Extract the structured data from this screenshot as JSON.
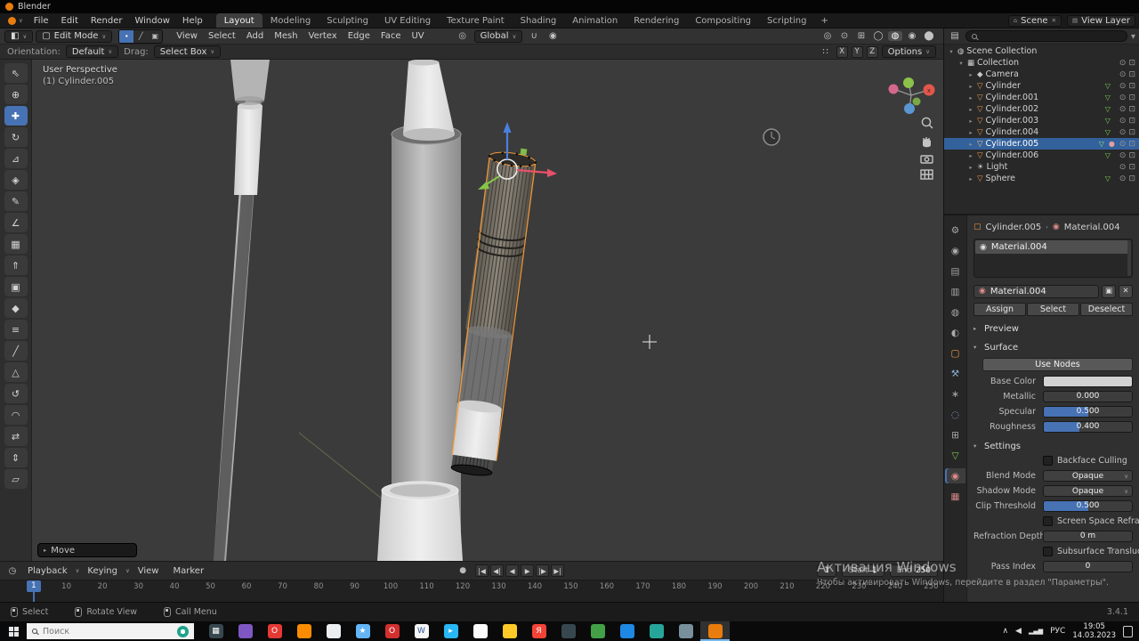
{
  "titlebar": {
    "app": "Blender"
  },
  "icons": {
    "chevron": "∨",
    "tri_r": "▸",
    "tri_d": "▾",
    "close": "✕",
    "plus": "+",
    "grid": "∷",
    "editor_3d": "◧",
    "editor_outliner": "▤",
    "editor_props": "⌂",
    "editor_timeline": "◷",
    "mode_cube": "▢",
    "pivot": "◎",
    "magnet": "∪",
    "proportional": "◉",
    "filter": "▼",
    "breadcrumb_sep": "›",
    "sphere": "◉",
    "copy": "▣",
    "caret_up": "∧",
    "volume": "◀",
    "network": "▂▄▆",
    "dot": "●"
  },
  "menubar": {
    "menus": [
      "File",
      "Edit",
      "Render",
      "Window",
      "Help"
    ],
    "workspaces": [
      {
        "label": "Layout",
        "active": true
      },
      {
        "label": "Modeling"
      },
      {
        "label": "Sculpting"
      },
      {
        "label": "UV Editing"
      },
      {
        "label": "Texture Paint"
      },
      {
        "label": "Shading"
      },
      {
        "label": "Animation"
      },
      {
        "label": "Rendering"
      },
      {
        "label": "Compositing"
      },
      {
        "label": "Scripting"
      }
    ],
    "scene_label": "Scene",
    "view_layer_label": "View Layer"
  },
  "viewport_header": {
    "mode": "Edit Mode",
    "select_modes": [
      {
        "name": "vertex-select",
        "glyph": "∙",
        "active": true
      },
      {
        "name": "edge-select",
        "glyph": "╱"
      },
      {
        "name": "face-select",
        "glyph": "▣"
      }
    ],
    "menus": [
      "View",
      "Select",
      "Add",
      "Mesh",
      "Vertex",
      "Edge",
      "Face",
      "UV"
    ],
    "orientation": "Global",
    "toggles": [
      {
        "name": "show-gizmo",
        "glyph": "◎"
      },
      {
        "name": "show-overlays",
        "glyph": "⊙"
      },
      {
        "name": "toggle-xray",
        "glyph": "⊞"
      },
      {
        "name": "shading-wireframe",
        "glyph": "◯"
      },
      {
        "name": "shading-solid",
        "glyph": "◍",
        "active": true
      },
      {
        "name": "shading-material",
        "glyph": "◉"
      },
      {
        "name": "shading-rendered",
        "glyph": "⬤"
      }
    ]
  },
  "tool_settings": {
    "orientation_label": "Orientation:",
    "orientation_value": "Default",
    "drag_label": "Drag:",
    "drag_value": "Select Box",
    "axes": [
      "X",
      "Y",
      "Z"
    ],
    "options_label": "Options"
  },
  "toolbar": {
    "tools": [
      {
        "name": "select-box",
        "glyph": "⇖"
      },
      {
        "name": "cursor",
        "glyph": "⊕"
      },
      {
        "name": "move",
        "glyph": "✚",
        "active": true
      },
      {
        "name": "rotate",
        "glyph": "↻"
      },
      {
        "name": "scale",
        "glyph": "⊿"
      },
      {
        "name": "transform",
        "glyph": "◈"
      },
      {
        "name": "annotate",
        "glyph": "✎"
      },
      {
        "name": "measure",
        "glyph": "∠"
      },
      {
        "name": "add-cube",
        "glyph": "▦"
      },
      {
        "name": "extrude-region",
        "glyph": "⇑"
      },
      {
        "name": "inset-faces",
        "glyph": "▣"
      },
      {
        "name": "bevel",
        "glyph": "◆"
      },
      {
        "name": "loop-cut",
        "glyph": "≡"
      },
      {
        "name": "knife",
        "glyph": "╱"
      },
      {
        "name": "poly-build",
        "glyph": "△"
      },
      {
        "name": "spin",
        "glyph": "↺"
      },
      {
        "name": "smooth",
        "glyph": "◠"
      },
      {
        "name": "edge-slide",
        "glyph": "⇄"
      },
      {
        "name": "shrink-fatten",
        "glyph": "⇕"
      },
      {
        "name": "shear",
        "glyph": "▱"
      }
    ]
  },
  "viewport": {
    "view_label": "User Perspective",
    "object_label": "(1) Cylinder.005",
    "operator_label": "Move",
    "gizmo_x_label": "x",
    "selection_color": "#f59a38",
    "accent_color": "#4772b3"
  },
  "outliner": {
    "items": [
      {
        "label": "Scene Collection",
        "arrow": "▾",
        "icon": "◍",
        "icon_color": "#d0d0d0",
        "indent": 0
      },
      {
        "label": "Collection",
        "arrow": "▾",
        "icon": "▦",
        "icon_color": "#d0d0d0",
        "indent": 1,
        "eye": "⊙",
        "cam": "⊡"
      },
      {
        "label": "Camera",
        "arrow": "▸",
        "icon": "◆",
        "icon_color": "#c9c9c9",
        "indent": 2,
        "eye": "⊙",
        "cam": "⊡"
      },
      {
        "label": "Cylinder",
        "arrow": "▸",
        "icon": "▽",
        "icon_color": "#ef9b4e",
        "badge": "▽",
        "badge_color": "#7fce52",
        "indent": 2,
        "eye": "⊙",
        "cam": "⊡"
      },
      {
        "label": "Cylinder.001",
        "arrow": "▸",
        "icon": "▽",
        "icon_color": "#ef9b4e",
        "badge": "▽",
        "badge_color": "#7fce52",
        "indent": 2,
        "eye": "⊙",
        "cam": "⊡"
      },
      {
        "label": "Cylinder.002",
        "arrow": "▸",
        "icon": "▽",
        "icon_color": "#ef9b4e",
        "badge": "▽",
        "badge_color": "#7fce52",
        "indent": 2,
        "eye": "⊙",
        "cam": "⊡"
      },
      {
        "label": "Cylinder.003",
        "arrow": "▸",
        "icon": "▽",
        "icon_color": "#ef9b4e",
        "badge": "▽",
        "badge_color": "#7fce52",
        "indent": 2,
        "eye": "⊙",
        "cam": "⊡"
      },
      {
        "label": "Cylinder.004",
        "arrow": "▸",
        "icon": "▽",
        "icon_color": "#ef9b4e",
        "badge": "▽",
        "badge_color": "#7fce52",
        "indent": 2,
        "eye": "⊙",
        "cam": "⊡"
      },
      {
        "label": "Cylinder.005",
        "arrow": "▸",
        "icon": "▽",
        "icon_color": "#ffc588",
        "badge": "▽",
        "badge_color": "#9fe07a",
        "badge2": "●",
        "badge2_color": "#e0a0a0",
        "indent": 2,
        "eye": "⊙",
        "cam": "⊡",
        "selected": true
      },
      {
        "label": "Cylinder.006",
        "arrow": "▸",
        "icon": "▽",
        "icon_color": "#ef9b4e",
        "badge": "▽",
        "badge_color": "#7fce52",
        "indent": 2,
        "eye": "⊙",
        "cam": "⊡"
      },
      {
        "label": "Light",
        "arrow": "▸",
        "icon": "☀",
        "icon_color": "#cfcfcf",
        "indent": 2,
        "eye": "⊙",
        "cam": "⊡"
      },
      {
        "label": "Sphere",
        "arrow": "▸",
        "icon": "▽",
        "icon_color": "#ef9b4e",
        "badge": "▽",
        "badge_color": "#7fce52",
        "indent": 2,
        "eye": "⊙",
        "cam": "⊡"
      }
    ]
  },
  "properties": {
    "tabs": [
      {
        "name": "tab-tool",
        "glyph": "⚙"
      },
      {
        "name": "tab-render",
        "glyph": "◉"
      },
      {
        "name": "tab-output",
        "glyph": "▤"
      },
      {
        "name": "tab-view-layer",
        "glyph": "▥"
      },
      {
        "name": "tab-scene",
        "glyph": "◍"
      },
      {
        "name": "tab-world",
        "glyph": "◐"
      },
      {
        "name": "tab-object",
        "glyph": "▢",
        "color": "#ef9b4e"
      },
      {
        "name": "tab-modifiers",
        "glyph": "⚒",
        "color": "#8aa8ce"
      },
      {
        "name": "tab-particles",
        "glyph": "∗"
      },
      {
        "name": "tab-physics",
        "glyph": "◌",
        "color": "#8aa8ce"
      },
      {
        "name": "tab-constraints",
        "glyph": "⊞"
      },
      {
        "name": "tab-object-data",
        "glyph": "▽",
        "color": "#7fce52"
      },
      {
        "name": "tab-material",
        "glyph": "◉",
        "color": "#de8a8a",
        "active": true
      },
      {
        "name": "tab-texture",
        "glyph": "▦",
        "color": "#de8a8a"
      }
    ],
    "breadcrumb_object": "Cylinder.005",
    "breadcrumb_material": "Material.004",
    "slot_item": "Material.004",
    "material_name": "Material.004",
    "assign": "Assign",
    "select": "Select",
    "deselect": "Deselect",
    "preview_label": "Preview",
    "surface_label": "Surface",
    "use_nodes": "Use Nodes",
    "base_color_label": "Base Color",
    "metallic_label": "Metallic",
    "metallic": "0.000",
    "specular_label": "Specular",
    "specular": "0.500",
    "roughness_label": "Roughness",
    "roughness": "0.400",
    "settings_label": "Settings",
    "backface_culling": "Backface Culling",
    "blend_mode_label": "Blend Mode",
    "blend_mode": "Opaque",
    "shadow_mode_label": "Shadow Mode",
    "shadow_mode": "Opaque",
    "clip_threshold_label": "Clip Threshold",
    "clip_threshold": "0.500",
    "screen_space_refraction": "Screen Space Refraction",
    "refraction_depth_label": "Refraction Depth",
    "refraction_depth": "0 m",
    "subsurface_translucency": "Subsurface Translucency",
    "pass_index_label": "Pass Index",
    "pass_index": "0"
  },
  "timeline": {
    "menus": [
      "Playback",
      "Keying",
      "View",
      "Marker"
    ],
    "record": "●",
    "controls": [
      {
        "name": "jump-start",
        "glyph": "|◀"
      },
      {
        "name": "keyframe-prev",
        "glyph": "◀|"
      },
      {
        "name": "play-reverse",
        "glyph": "◀"
      },
      {
        "name": "play",
        "glyph": "▶"
      },
      {
        "name": "keyframe-next",
        "glyph": "|▶"
      },
      {
        "name": "jump-end",
        "glyph": "▶|"
      }
    ],
    "current_frame": "1",
    "start_label": "Start",
    "start_value": "1",
    "end_label": "End",
    "end_value": "250",
    "ticks": [
      "1",
      "10",
      "20",
      "30",
      "40",
      "50",
      "60",
      "70",
      "80",
      "90",
      "100",
      "110",
      "120",
      "130",
      "140",
      "150",
      "160",
      "170",
      "180",
      "190",
      "200",
      "210",
      "220",
      "230",
      "240",
      "250"
    ]
  },
  "statusbar": {
    "hints": [
      "Select",
      "Rotate View",
      "Call Menu"
    ],
    "version": "3.4.1"
  },
  "watermark": {
    "line1": "Активация Windows",
    "line2": "Чтобы активировать Windows, перейдите в раздел \"Параметры\"."
  },
  "taskbar": {
    "search_placeholder": "Поиск",
    "lang": "РУС",
    "time": "19:05",
    "date": "14.03.2023",
    "icons": [
      {
        "name": "task-view",
        "color": "#37474f",
        "glyph": "▦"
      },
      {
        "name": "app-purple",
        "color": "#7e57c2"
      },
      {
        "name": "app-opera",
        "color": "#e53935",
        "glyph": "O"
      },
      {
        "name": "app-firefox",
        "color": "#fb8c00"
      },
      {
        "name": "app-notepad",
        "color": "#eceff1"
      },
      {
        "name": "app-star",
        "color": "#64b5f6",
        "glyph": "★"
      },
      {
        "name": "app-opera-2",
        "color": "#d32f2f",
        "glyph": "O"
      },
      {
        "name": "app-word",
        "color": "#f5f5f5",
        "glyph": "W",
        "glyph_color": "#2b579a"
      },
      {
        "name": "app-telegram",
        "color": "#29b6f6",
        "glyph": "▸"
      },
      {
        "name": "app-white",
        "color": "#fafafa"
      },
      {
        "name": "app-explorer",
        "color": "#ffca28"
      },
      {
        "name": "app-yandex",
        "color": "#f44336",
        "glyph": "Я"
      },
      {
        "name": "app-dark",
        "color": "#37474f"
      },
      {
        "name": "app-green",
        "color": "#43a047"
      },
      {
        "name": "app-blue",
        "color": "#1e88e5"
      },
      {
        "name": "app-teal",
        "color": "#26a69a"
      },
      {
        "name": "app-gray",
        "color": "#78909c"
      },
      {
        "name": "app-blender",
        "color": "#e87d0d",
        "active": true
      }
    ]
  }
}
